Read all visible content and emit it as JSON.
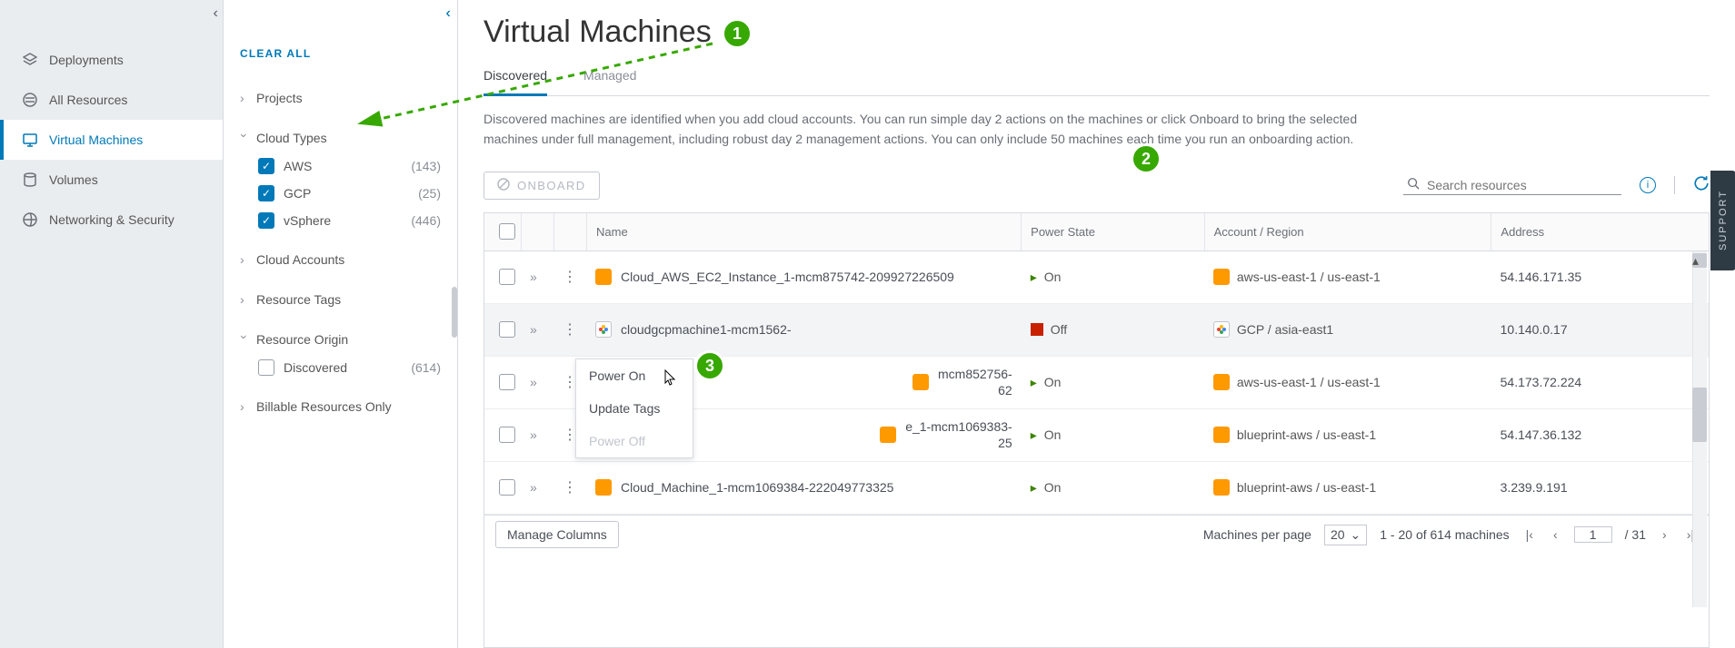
{
  "nav": {
    "items": [
      {
        "label": "Deployments"
      },
      {
        "label": "All Resources"
      },
      {
        "label": "Virtual Machines"
      },
      {
        "label": "Volumes"
      },
      {
        "label": "Networking & Security"
      }
    ]
  },
  "filters": {
    "clear_all": "CLEAR ALL",
    "groups": {
      "projects": {
        "label": "Projects"
      },
      "cloud_types": {
        "label": "Cloud Types",
        "options": [
          {
            "label": "AWS",
            "count": "(143)",
            "checked": true
          },
          {
            "label": "GCP",
            "count": "(25)",
            "checked": true
          },
          {
            "label": "vSphere",
            "count": "(446)",
            "checked": true
          }
        ]
      },
      "cloud_accounts": {
        "label": "Cloud Accounts"
      },
      "resource_tags": {
        "label": "Resource Tags"
      },
      "resource_origin": {
        "label": "Resource Origin",
        "options": [
          {
            "label": "Discovered",
            "count": "(614)",
            "checked": false
          }
        ]
      },
      "billable": {
        "label": "Billable Resources Only"
      }
    }
  },
  "page": {
    "title": "Virtual Machines",
    "tabs": [
      {
        "label": "Discovered",
        "active": true
      },
      {
        "label": "Managed",
        "active": false
      }
    ],
    "description": "Discovered machines are identified when you add cloud accounts. You can run simple day 2 actions on the machines or click Onboard to bring the selected machines under full management, including robust day 2 management actions. You can only include 50 machines each time you run an onboarding action.",
    "onboard_label": "ONBOARD",
    "search": {
      "placeholder": "Search resources"
    }
  },
  "columns": {
    "name": "Name",
    "power": "Power State",
    "account": "Account / Region",
    "address": "Address"
  },
  "rows": [
    {
      "name": "Cloud_AWS_EC2_Instance_1-mcm875742-209927226509",
      "provider": "aws",
      "power": "On",
      "on": true,
      "account": "aws-us-east-1 / us-east-1",
      "address": "54.146.171.35"
    },
    {
      "name": "cloudgcpmachine1-mcm1562-",
      "provider": "gcp",
      "power": "Off",
      "on": false,
      "account": "GCP / asia-east1",
      "address": "10.140.0.17",
      "shaded": true
    },
    {
      "name": "mcm852756-",
      "suffix": "62",
      "provider": "aws",
      "power": "On",
      "on": true,
      "account": "aws-us-east-1 / us-east-1",
      "address": "54.173.72.224"
    },
    {
      "name": "e_1-mcm1069383-",
      "suffix": "25",
      "provider": "aws",
      "power": "On",
      "on": true,
      "account": "blueprint-aws / us-east-1",
      "address": "54.147.36.132"
    },
    {
      "name": "Cloud_Machine_1-mcm1069384-222049773325",
      "provider": "aws",
      "power": "On",
      "on": true,
      "account": "blueprint-aws / us-east-1",
      "address": "3.239.9.191"
    }
  ],
  "context_menu": {
    "items": [
      {
        "label": "Power On",
        "disabled": false
      },
      {
        "label": "Update Tags",
        "disabled": false
      },
      {
        "label": "Power Off",
        "disabled": true
      }
    ]
  },
  "footer": {
    "manage_columns": "Manage Columns",
    "per_page_label": "Machines per page",
    "per_page_value": "20",
    "range_text": "1 - 20 of 614 machines",
    "page_current": "1",
    "page_sep": "/ 31"
  },
  "support_label": "SUPPORT"
}
